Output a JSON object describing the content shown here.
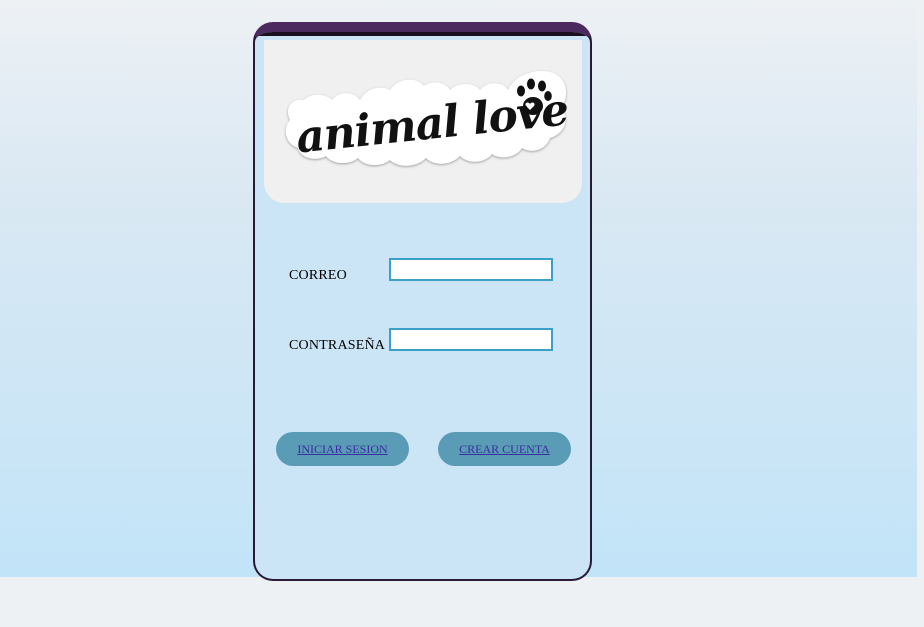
{
  "logo": {
    "text": "animal lover",
    "icon": "paw-icon"
  },
  "form": {
    "email_label": "CORREO",
    "email_value": "",
    "password_label": "CONTRASEÑA",
    "password_value": ""
  },
  "buttons": {
    "login_label": "INICIAR SESION",
    "signup_label": "CREAR CUENTA"
  },
  "colors": {
    "frame_top": "#4b2a60",
    "frame_border": "#2a1a36",
    "input_border": "#3aa0c8",
    "button_bg": "#5a9bb6",
    "link_text": "#3a2fa0"
  }
}
